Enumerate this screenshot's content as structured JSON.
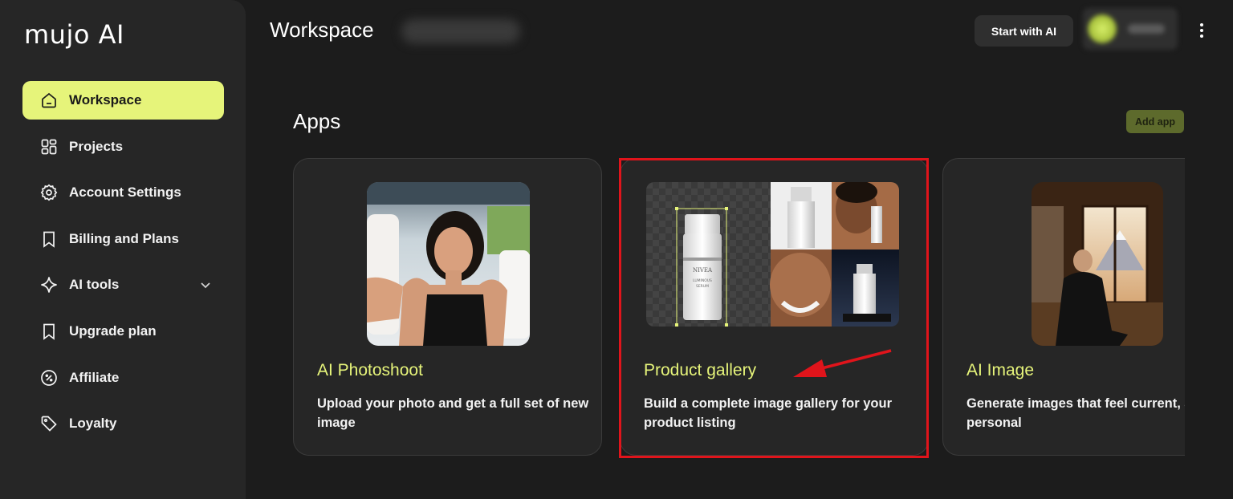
{
  "app": {
    "logo": "mujo AI"
  },
  "sidebar": {
    "items": [
      {
        "label": "Workspace",
        "icon": "home-icon",
        "active": true
      },
      {
        "label": "Projects",
        "icon": "grid-icon"
      },
      {
        "label": "Account Settings",
        "icon": "gear-icon"
      },
      {
        "label": "Billing and Plans",
        "icon": "bookmark-icon"
      },
      {
        "label": "AI tools",
        "icon": "sparkle-icon",
        "expandable": true
      },
      {
        "label": "Upgrade plan",
        "icon": "bookmark-icon"
      },
      {
        "label": "Affiliate",
        "icon": "discount-badge-icon"
      },
      {
        "label": "Loyalty",
        "icon": "tag-icon"
      }
    ]
  },
  "header": {
    "title": "Workspace",
    "start_button": "Start with AI"
  },
  "apps": {
    "title": "Apps",
    "add_button": "Add app",
    "cards": [
      {
        "title": "AI Photoshoot",
        "description": "Upload your photo and get a full set of new image"
      },
      {
        "title": "Product gallery",
        "description": "Build a complete image gallery for your product listing",
        "highlighted": true
      },
      {
        "title": "AI Image",
        "description": "Generate images that feel current, and personal"
      }
    ]
  },
  "product_image_text": {
    "brand": "NIVEA",
    "line1": "LUMINOUS",
    "line2": "SERUM"
  },
  "colors": {
    "accent": "#e6f47a",
    "highlight": "#e0141b",
    "background": "#1c1c1c",
    "sidebar": "#262626"
  }
}
